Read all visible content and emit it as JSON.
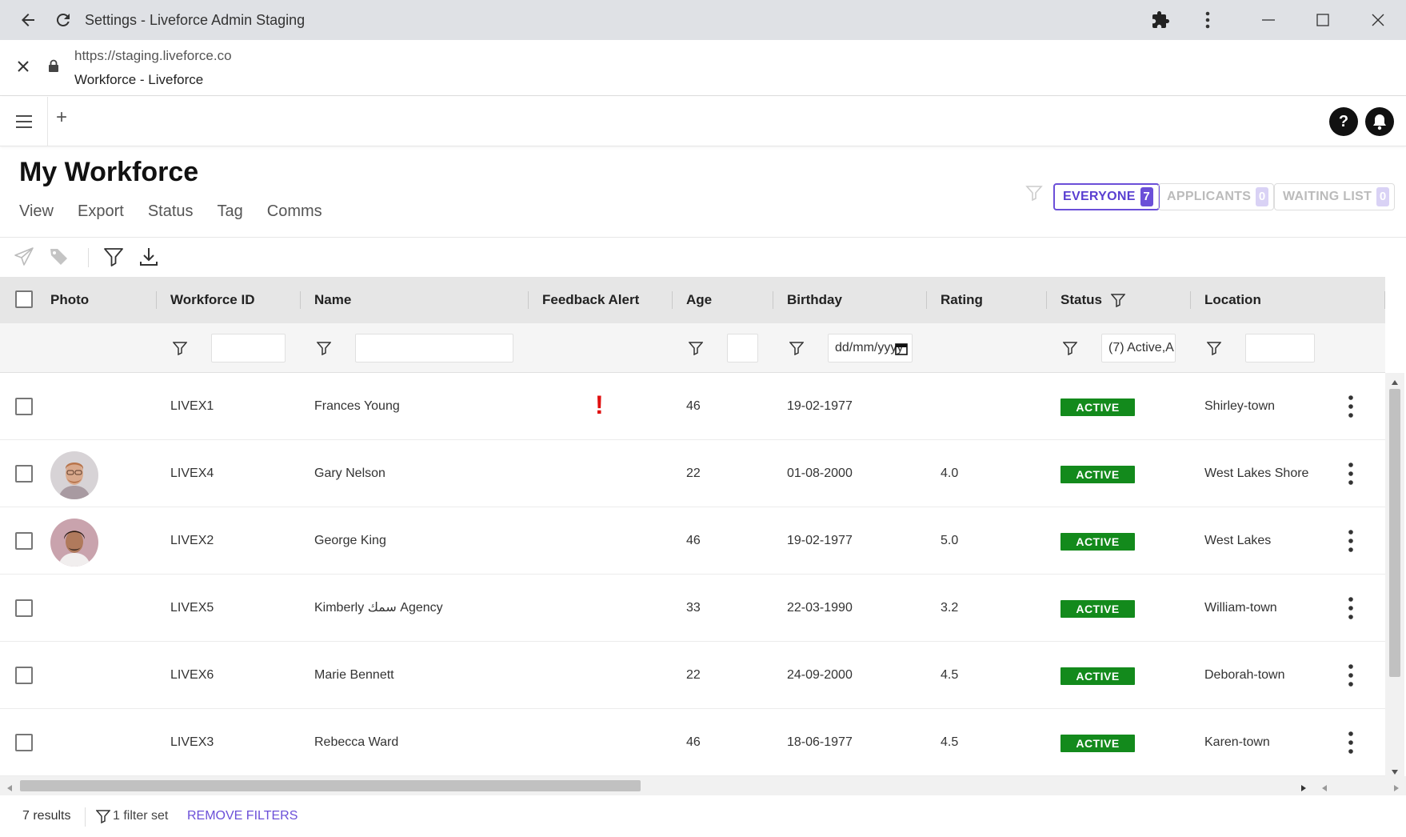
{
  "browser": {
    "window_title": "Settings - Liveforce Admin Staging",
    "url": "https://staging.liveforce.co",
    "page_title": "Workforce - Liveforce"
  },
  "page": {
    "title": "My Workforce",
    "menu": [
      "View",
      "Export",
      "Status",
      "Tag",
      "Comms"
    ],
    "segments": [
      {
        "label": "EVERYONE",
        "count": "7"
      },
      {
        "label": "APPLICANTS",
        "count": "0"
      },
      {
        "label": "WAITING LIST",
        "count": "0"
      }
    ]
  },
  "table": {
    "columns": {
      "photo": "Photo",
      "workforce_id": "Workforce ID",
      "name": "Name",
      "feedback_alert": "Feedback Alert",
      "age": "Age",
      "birthday": "Birthday",
      "rating": "Rating",
      "status": "Status",
      "location": "Location"
    },
    "filters": {
      "birthday_placeholder": "dd/mm/yyyy",
      "status_value": "(7) Active,A"
    },
    "rows": [
      {
        "id": "LIVEX1",
        "name": "Frances Young",
        "alert": "!",
        "age": "46",
        "birthday": "19-02-1977",
        "rating": "",
        "status": "ACTIVE",
        "location": "Shirley-town"
      },
      {
        "id": "LIVEX4",
        "name": "Gary Nelson",
        "alert": "",
        "age": "22",
        "birthday": "01-08-2000",
        "rating": "4.0",
        "status": "ACTIVE",
        "location": "West Lakes Shore"
      },
      {
        "id": "LIVEX2",
        "name": "George King",
        "alert": "",
        "age": "46",
        "birthday": "19-02-1977",
        "rating": "5.0",
        "status": "ACTIVE",
        "location": "West Lakes"
      },
      {
        "id": "LIVEX5",
        "name": "Kimberly سمك Agency",
        "alert": "",
        "age": "33",
        "birthday": "22-03-1990",
        "rating": "3.2",
        "status": "ACTIVE",
        "location": "William-town"
      },
      {
        "id": "LIVEX6",
        "name": "Marie Bennett",
        "alert": "",
        "age": "22",
        "birthday": "24-09-2000",
        "rating": "4.5",
        "status": "ACTIVE",
        "location": "Deborah-town"
      },
      {
        "id": "LIVEX3",
        "name": "Rebecca Ward",
        "alert": "",
        "age": "46",
        "birthday": "18-06-1977",
        "rating": "4.5",
        "status": "ACTIVE",
        "location": "Karen-town"
      }
    ]
  },
  "footer": {
    "results": "7 results",
    "filter_set": "1 filter set",
    "remove_filters": "REMOVE FILTERS"
  },
  "colors": {
    "accent": "#6b4fd8",
    "active_badge": "#138a1c",
    "alert": "#e01010"
  }
}
